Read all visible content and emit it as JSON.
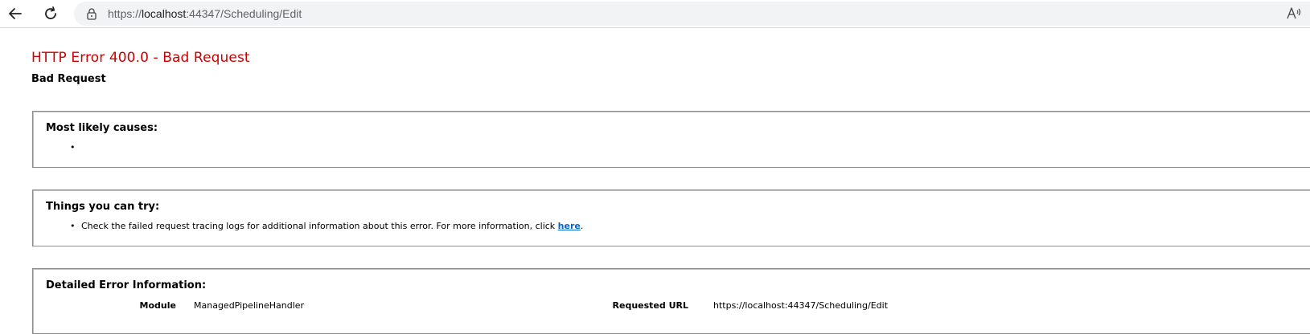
{
  "browser": {
    "url_scheme": "https://",
    "url_host": "localhost",
    "url_rest": ":44347/Scheduling/Edit",
    "read_aloud_label": "A"
  },
  "page": {
    "title": "HTTP Error 400.0 - Bad Request",
    "subtitle": "Bad Request"
  },
  "causes": {
    "heading": "Most likely causes:",
    "items": [
      ""
    ]
  },
  "try": {
    "heading": "Things you can try:",
    "item_text": "Check the failed request tracing logs for additional information about this error. For more information, click ",
    "link_text": "here",
    "item_suffix": "."
  },
  "details": {
    "heading": "Detailed Error Information:",
    "module_label": "Module",
    "module_value": "ManagedPipelineHandler",
    "requested_url_label": "Requested URL",
    "requested_url_value": "https://localhost:44347/Scheduling/Edit"
  },
  "colors": {
    "error_red": "#cc0000",
    "link_blue": "#0066cc",
    "panel_border": "#8e8e8e"
  }
}
